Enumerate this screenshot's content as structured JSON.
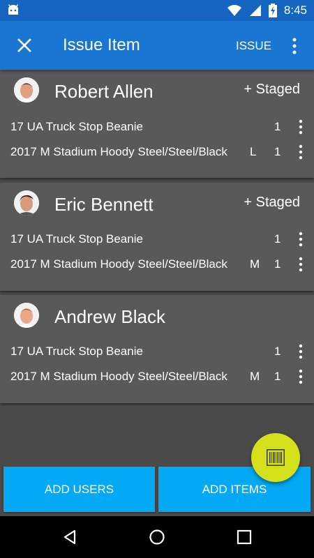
{
  "status_bar": {
    "time": "8:45",
    "icons": [
      "android-icon",
      "wifi-icon",
      "signal-icon",
      "battery-charging-icon"
    ]
  },
  "app_bar": {
    "title": "Issue Item",
    "action_label": "ISSUE",
    "close_icon": "close-icon",
    "more_icon": "more-vert-icon"
  },
  "users": [
    {
      "name": "Robert Allen",
      "status": "+ Staged",
      "items": [
        {
          "name": "17 UA Truck Stop Beanie",
          "size": "",
          "qty": "1"
        },
        {
          "name": "2017  M Stadium Hoody Steel/Steel/Black",
          "size": "L",
          "qty": "1"
        }
      ]
    },
    {
      "name": "Eric Bennett",
      "status": "+ Staged",
      "items": [
        {
          "name": "17 UA Truck Stop Beanie",
          "size": "",
          "qty": "1"
        },
        {
          "name": "2017  M Stadium Hoody Steel/Steel/Black",
          "size": "M",
          "qty": "1"
        }
      ]
    },
    {
      "name": "Andrew Black",
      "status": "",
      "items": [
        {
          "name": "17 UA Truck Stop Beanie",
          "size": "",
          "qty": "1"
        },
        {
          "name": "2017  M Stadium Hoody Steel/Steel/Black",
          "size": "M",
          "qty": "1"
        }
      ]
    }
  ],
  "fab": {
    "icon": "barcode-scan-icon"
  },
  "bottom_buttons": {
    "add_users": "ADD USERS",
    "add_items": "ADD ITEMS"
  },
  "nav_bar": {
    "icons": [
      "back-icon",
      "home-icon",
      "recents-icon"
    ]
  },
  "colors": {
    "status_bar": "#1565c0",
    "app_bar": "#1976d2",
    "background": "#4a4a4a",
    "card": "#595959",
    "button": "#03a9f4",
    "fab": "#d4e01a"
  }
}
